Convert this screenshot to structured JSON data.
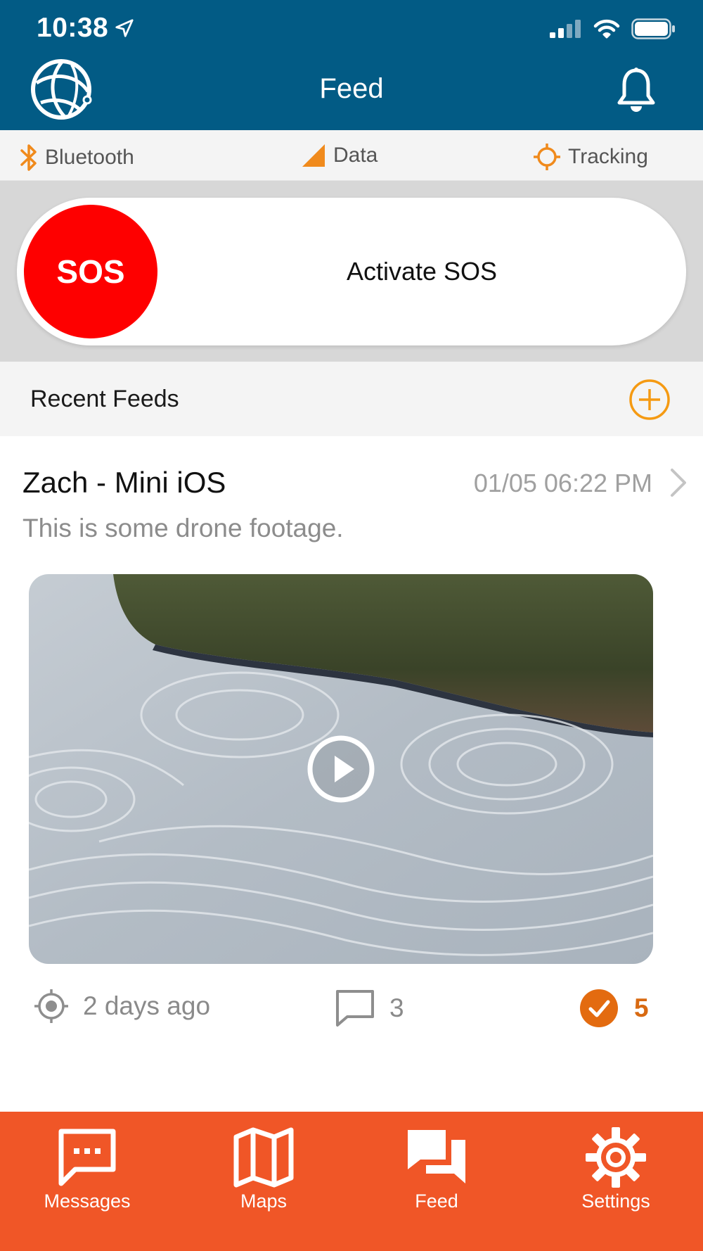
{
  "status_bar": {
    "time": "10:38"
  },
  "header": {
    "title": "Feed"
  },
  "connections": {
    "bluetooth": "Bluetooth",
    "data": "Data",
    "tracking": "Tracking"
  },
  "sos": {
    "button_label": "SOS",
    "action_label": "Activate SOS"
  },
  "recent": {
    "title": "Recent Feeds"
  },
  "feed": {
    "author": "Zach - Mini iOS",
    "timestamp": "01/05 06:22 PM",
    "description": "This is some drone footage.",
    "location_time": "2 days ago",
    "comments": "3",
    "likes": "5"
  },
  "tabs": [
    {
      "label": "Messages"
    },
    {
      "label": "Maps"
    },
    {
      "label": "Feed"
    },
    {
      "label": "Settings"
    }
  ],
  "colors": {
    "header": "#025b85",
    "accent": "#f05627",
    "sos": "#fe0000",
    "orange_icon": "#f08a1c"
  }
}
